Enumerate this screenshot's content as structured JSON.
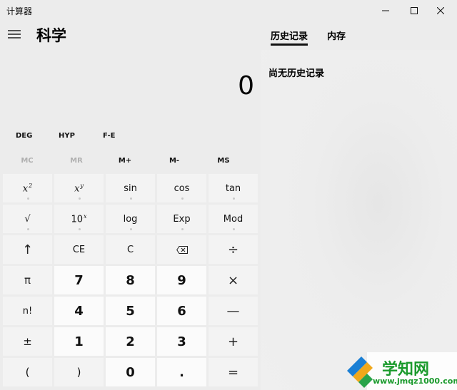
{
  "app": {
    "title": "计算器",
    "mode": "科学"
  },
  "display": {
    "value": "0"
  },
  "panel": {
    "tabs": [
      {
        "label": "历史记录"
      },
      {
        "label": "内存"
      }
    ],
    "empty_message": "尚无历史记录"
  },
  "modes": {
    "angle": "DEG",
    "hyp": "HYP",
    "fe": "F-E"
  },
  "memory": {
    "mc": "MC",
    "mr": "MR",
    "mplus": "M+",
    "mminus": "M-",
    "ms": "MS"
  },
  "keys": {
    "x2": "x²",
    "xy": "xʸ",
    "sin": "sin",
    "cos": "cos",
    "tan": "tan",
    "sqrt": "√",
    "tenx": "10ˣ",
    "log": "log",
    "exp": "Exp",
    "mod": "Mod",
    "shift": "↑",
    "ce": "CE",
    "c": "C",
    "backspace": "⌫",
    "divide": "÷",
    "pi": "π",
    "seven": "7",
    "eight": "8",
    "nine": "9",
    "multiply": "×",
    "factorial": "n!",
    "four": "4",
    "five": "5",
    "six": "6",
    "minus": "—",
    "negate": "±",
    "one": "1",
    "two": "2",
    "three": "3",
    "plus": "+",
    "lparen": "(",
    "rparen": ")",
    "zero": "0",
    "decimal": ".",
    "equals": "="
  },
  "watermark": {
    "text": "学知网",
    "url": "www.jmqz1000.com"
  },
  "icons": {
    "menu": "hamburger-icon",
    "minimize": "minimize-icon",
    "maximize": "maximize-icon",
    "close": "close-icon",
    "backspace": "backspace-icon"
  }
}
